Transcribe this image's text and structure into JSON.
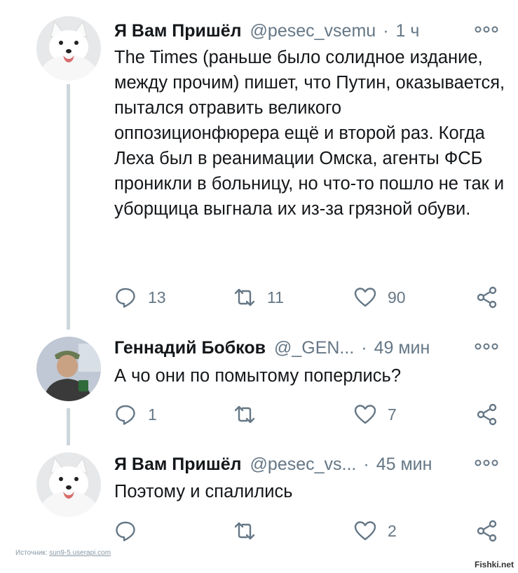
{
  "tweets": [
    {
      "name": "Я Вам Пришёл",
      "handle": "@pesec_vsemu",
      "separator": "·",
      "time": "1 ч",
      "text": "The Times (раньше было солидное издание, между прочим) пишет, что Путин, оказывается, пытался отравить великого оппозиционфюрера ещё и второй раз. Когда Леха был в реанимации Омска, агенты ФСБ проникли в больницу, но что-то пошло не так и уборщица выгнала их из-за грязной обуви.",
      "replies": "13",
      "retweets": "11",
      "likes": "90",
      "avatar": "arctic-fox-avatar"
    },
    {
      "name": "Геннадий Бобков",
      "handle": "@_GEN...",
      "separator": "·",
      "time": "49 мин",
      "text": "А чо они по помытому поперлись?",
      "replies": "1",
      "retweets": "",
      "likes": "7",
      "avatar": "man-with-mug-avatar"
    },
    {
      "name": "Я Вам Пришёл",
      "handle": "@pesec_vs...",
      "separator": "·",
      "time": "45 мин",
      "text": "Поэтому и спалились",
      "replies": "",
      "retweets": "",
      "likes": "2",
      "avatar": "arctic-fox-avatar"
    }
  ],
  "footer": {
    "source_label": "Источник:",
    "source_link": "sun9-5.userapi.com",
    "watermark": "Fishki.net"
  },
  "colors": {
    "text": "#14171a",
    "muted": "#657786",
    "thread_line": "#ccd6dd",
    "icon": "#657786"
  }
}
